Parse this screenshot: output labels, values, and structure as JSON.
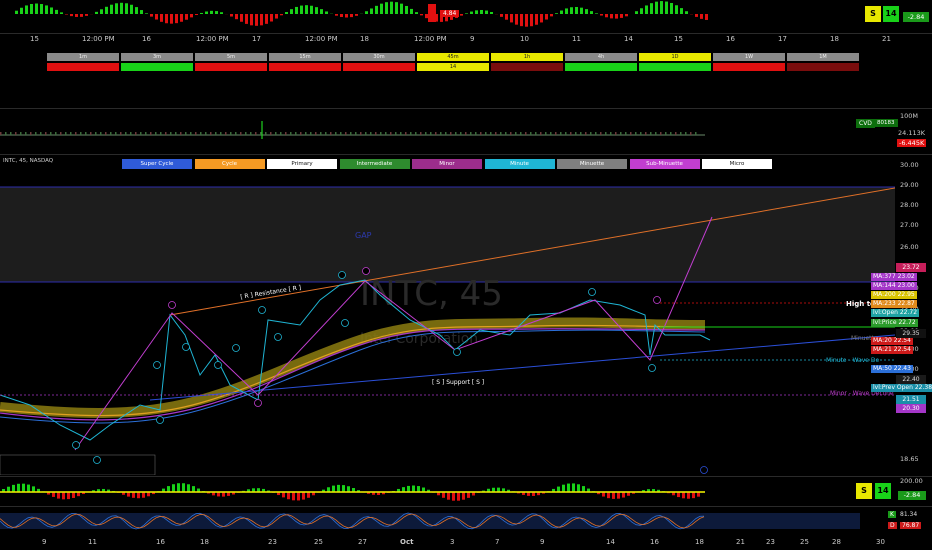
{
  "top_axis": {
    "ticks": [
      "15",
      "12:00 PM",
      "16",
      "12:00 PM",
      "17",
      "12:00 PM",
      "18",
      "12:00 PM",
      "9",
      "10",
      "11",
      "14",
      "15",
      "16",
      "17",
      "18",
      "21"
    ],
    "s_badge": "S",
    "count_badge": "14",
    "value_pill": "-2.84",
    "indicator_value": "4.84"
  },
  "timeframes": {
    "labels": [
      "1m",
      "3m",
      "5m",
      "15m",
      "30m",
      "45m",
      "1h",
      "4h",
      "1D",
      "1W",
      "1M"
    ],
    "active_label_value": "14"
  },
  "cvd": {
    "label": "CVD",
    "value_label": "80183",
    "scale_top": "100M",
    "value_green": "24.113K",
    "value_red": "-6.445K"
  },
  "symbol": {
    "name": "INTC, 45, NASDAQ",
    "watermark": "INTC, 45",
    "watermark_sub": "Intel Corporation"
  },
  "wave_legend": [
    "Super Cycle",
    "Cycle",
    "Primary",
    "Intermediate",
    "Minor",
    "Minute",
    "Minuette",
    "Sub-Minuette",
    "Micro"
  ],
  "wave_colors": [
    "#2f5bd8",
    "#f59a23",
    "#ffffff",
    "#2e8b2e",
    "#9c2d8c",
    "#1fb5d4",
    "#7f7f7f",
    "#c13ed0",
    "#ffffff"
  ],
  "price_axis": [
    "30.00",
    "29.00",
    "28.00",
    "27.00",
    "26.00",
    "25.00",
    "24.00",
    "23.00",
    "22.00",
    "21.00",
    "20.00",
    "19.00",
    "18.65"
  ],
  "price_tags": [
    {
      "text": "MA:377",
      "val": "23.02",
      "color": "#a436c8"
    },
    {
      "text": "MA:144",
      "val": "23.00",
      "color": "#a436c8"
    },
    {
      "text": "MA:200",
      "val": "22.95",
      "color": "#d9c300"
    },
    {
      "text": "MA:233",
      "val": "22.87",
      "color": "#e08a1b"
    },
    {
      "text": "lvl:Open",
      "val": "22.72",
      "color": "#1fa3a3"
    },
    {
      "text": "lvl:Price",
      "val": "22.72",
      "color": "#2b9b2b"
    },
    {
      "text": "MA:20",
      "val": "22.54",
      "color": "#cc1a1a"
    },
    {
      "text": "MA:21",
      "val": "22.54",
      "color": "#cc1a1a"
    },
    {
      "text": "MA:50",
      "val": "22.43",
      "color": "#2b6fd8"
    },
    {
      "text": "lvl:Prev Open",
      "val": "22.38",
      "color": "#1a8fa8"
    }
  ],
  "right_values": {
    "top": "23.72",
    "price": "29.35",
    "v1": "22.40",
    "v2": "21.51",
    "v3": "20.30"
  },
  "annotations": {
    "resistance": "[ R ] Resistance [ R ]",
    "support": "[ S ] Support [ S ]",
    "high_to": "High to",
    "minuette": "Minuette",
    "minute_wave": "Minute - Wave De",
    "minor_wave": "Minor - Wave Decline",
    "gap": "GAP"
  },
  "osc1": {
    "s_badge": "S",
    "count_badge": "14",
    "value_pill": "-2.84",
    "scale": "200.00"
  },
  "osc2": {
    "k_label": "K",
    "k_val": "81.34",
    "d_label": "D",
    "d_val": "76.87"
  },
  "bottom_axis": [
    "9",
    "11",
    "16",
    "18",
    "23",
    "25",
    "27",
    "Oct",
    "3",
    "7",
    "9",
    "14",
    "16",
    "18",
    "21",
    "23",
    "25",
    "28",
    "30"
  ],
  "colors": {
    "bg": "#000000",
    "bull": "#19d219",
    "bear": "#e01010",
    "highlight": "#e8e800"
  }
}
